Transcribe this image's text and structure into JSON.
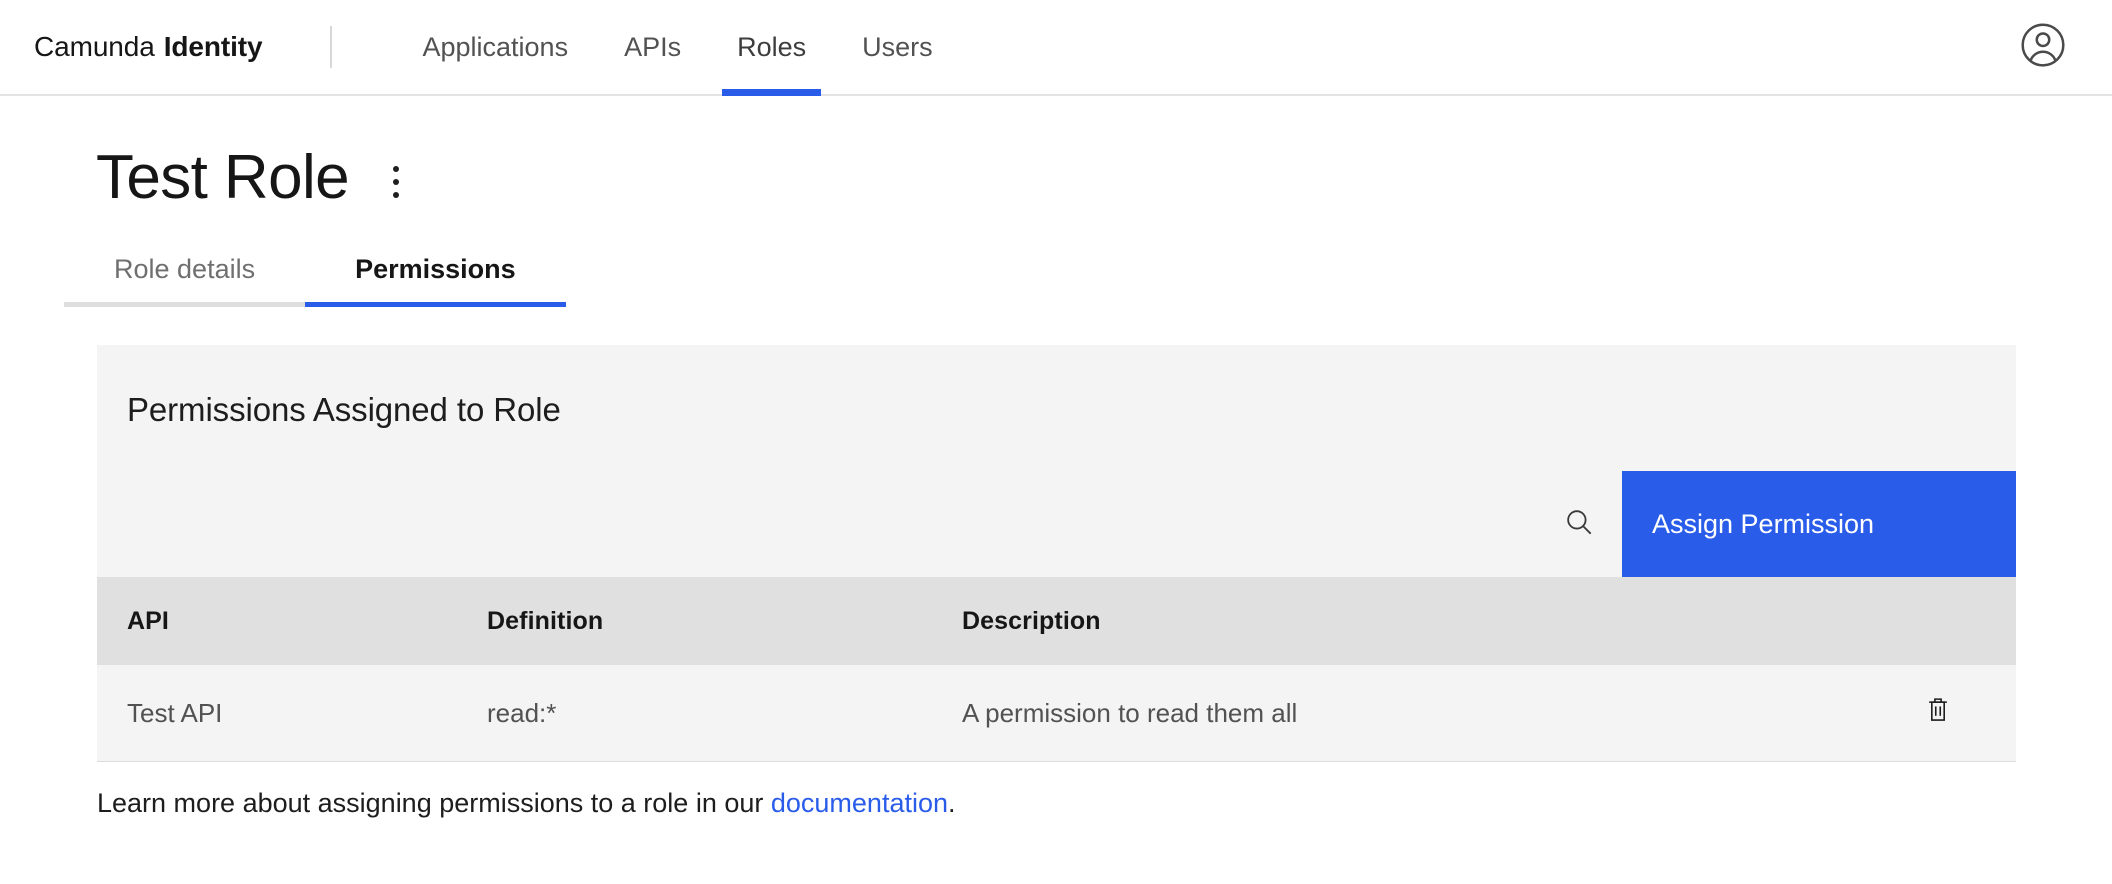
{
  "header": {
    "brand_prefix": "Camunda",
    "brand_strong": "Identity",
    "nav": [
      {
        "label": "Applications",
        "active": false
      },
      {
        "label": "APIs",
        "active": false
      },
      {
        "label": "Roles",
        "active": true
      },
      {
        "label": "Users",
        "active": false
      }
    ],
    "avatar_icon": "user-circle-icon"
  },
  "page": {
    "title": "Test Role",
    "kebab_icon": "overflow-menu-vertical-icon"
  },
  "subtabs": [
    {
      "label": "Role details",
      "active": false
    },
    {
      "label": "Permissions",
      "active": true
    }
  ],
  "panel": {
    "title": "Permissions Assigned to Role",
    "search_icon": "search-icon",
    "assign_button_label": "Assign Permission"
  },
  "table": {
    "columns": [
      "API",
      "Definition",
      "Description",
      ""
    ],
    "rows": [
      {
        "api": "Test API",
        "definition": "read:*",
        "description": "A permission to read them all",
        "delete_icon": "trash-can-icon"
      }
    ]
  },
  "footer": {
    "text_before": "Learn more about assigning permissions to a role in our ",
    "link_label": "documentation",
    "text_after": "."
  },
  "colors": {
    "accent_blue": "#2a5cea",
    "panel_bg": "#f4f4f4",
    "table_head_bg": "#e0e0e0",
    "text_primary": "#161616",
    "text_secondary": "#525252"
  }
}
